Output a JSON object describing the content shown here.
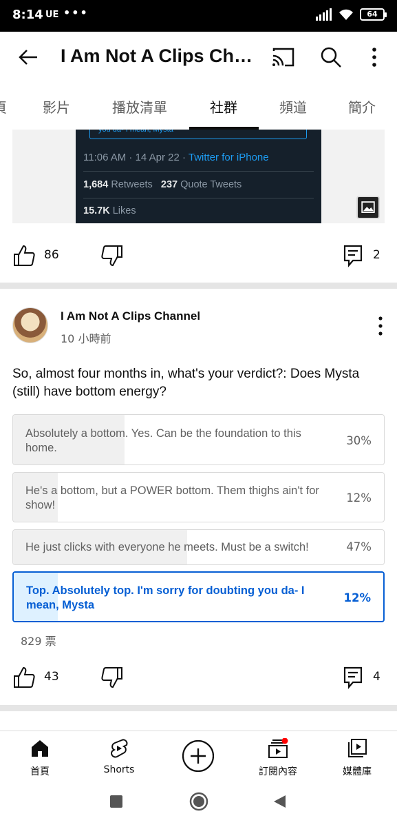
{
  "status_bar": {
    "time": "8:14",
    "carrier": "UE",
    "dots": "•••",
    "battery": "64"
  },
  "app_bar": {
    "title": "I Am Not A Clips Channel"
  },
  "tabs": [
    {
      "label": "頁"
    },
    {
      "label": "影片"
    },
    {
      "label": "播放清單"
    },
    {
      "label": "社群"
    },
    {
      "label": "頻道"
    },
    {
      "label": "簡介"
    }
  ],
  "tweet": {
    "quote_snippet": "you da- I mean, Mysta",
    "time": "11:06 AM · 14 Apr 22 · ",
    "source": "Twitter for iPhone",
    "retweets_count": "1,684",
    "retweets_label": "Retweets",
    "quotes_count": "237",
    "quotes_label": "Quote Tweets",
    "likes_count": "15.7K",
    "likes_label": "Likes"
  },
  "post1_actions": {
    "likes": "86",
    "comments": "2"
  },
  "post2": {
    "channel": "I Am Not A Clips Channel",
    "time": "10 小時前",
    "text": "So, almost four months in, what's your verdict?: Does Mysta (still) have bottom energy?",
    "poll": {
      "options": [
        {
          "label": "Absolutely a bottom. Yes. Can be the foundation to this home.",
          "percent": "30%",
          "value": 30,
          "selected": false
        },
        {
          "label": "He's a bottom, but a POWER bottom. Them thighs ain't for show!",
          "percent": "12%",
          "value": 12,
          "selected": false
        },
        {
          "label": "He just clicks with everyone he meets. Must be a switch!",
          "percent": "47%",
          "value": 47,
          "selected": false
        },
        {
          "label": "Top. Absolutely top. I'm sorry for doubting you da- I mean, Mysta",
          "percent": "12%",
          "value": 12,
          "selected": true
        }
      ],
      "votes": "829 票"
    },
    "actions": {
      "likes": "43",
      "comments": "4"
    }
  },
  "bottom_nav": [
    {
      "label": "首頁",
      "icon": "home-icon"
    },
    {
      "label": "Shorts",
      "icon": "shorts-icon"
    },
    {
      "label": "",
      "icon": "create-icon"
    },
    {
      "label": "訂閱內容",
      "icon": "subscriptions-icon"
    },
    {
      "label": "媒體庫",
      "icon": "library-icon"
    }
  ],
  "colors": {
    "accent": "#065fd4",
    "selected_fill": "#def1ff",
    "notification": "#ff0000"
  }
}
